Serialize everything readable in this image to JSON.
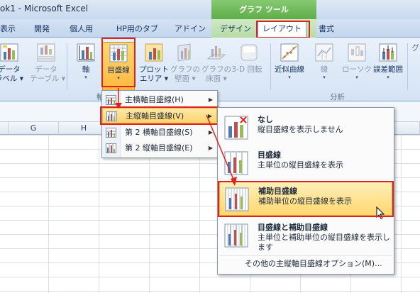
{
  "window": {
    "title": "ok1 - Microsoft Excel",
    "context_tab_group": "グラフ ツール"
  },
  "tabs": [
    {
      "label": "表示"
    },
    {
      "label": "開発"
    },
    {
      "label": "個人用"
    },
    {
      "label": "HP用のタブ"
    },
    {
      "label": "アドイン"
    },
    {
      "label": "デザイン"
    },
    {
      "label": "レイアウト",
      "active": true
    },
    {
      "label": "書式"
    }
  ],
  "ribbon": {
    "buttons": [
      {
        "label1": "データ",
        "label2": "ラベル ▾"
      },
      {
        "label1": "データ",
        "label2": "テーブル ▾"
      },
      {
        "label1": "軸",
        "label2": "▾"
      },
      {
        "label1": "目盛線",
        "label2": "▾"
      },
      {
        "label1": "プロット",
        "label2": "エリア ▾"
      },
      {
        "label1": "グラフの",
        "label2": "壁面 ▾"
      },
      {
        "label1": "グラフの",
        "label2": "床面 ▾"
      },
      {
        "label1": "3-D 回転",
        "label2": ""
      },
      {
        "label1": "近似曲線",
        "label2": "▾"
      },
      {
        "label1": "線",
        "label2": "▾"
      },
      {
        "label1": "ローソク",
        "label2": "▾"
      },
      {
        "label1": "誤差範囲",
        "label2": "▾"
      }
    ],
    "groups": {
      "axes_partial": "軸",
      "analysis": "分析"
    },
    "right_partial": "グ"
  },
  "sheet": {
    "columns": [
      "G",
      "H"
    ]
  },
  "submenu1": {
    "items": [
      {
        "label": "主横軸目盛線(H)"
      },
      {
        "label": "主縦軸目盛線(V)"
      },
      {
        "label": "第 2 横軸目盛線(S)"
      },
      {
        "label": "第 2 縦軸目盛線(E)"
      }
    ]
  },
  "submenu2": {
    "options": [
      {
        "title": "なし",
        "desc": "縦目盛線を表示しません"
      },
      {
        "title": "目盛線",
        "desc": "主単位の縦目盛線を表示"
      },
      {
        "title": "補助目盛線",
        "desc": "補助単位の縦目盛線を表示"
      },
      {
        "title": "目盛線と補助目盛線",
        "desc": "主単位と補助単位の縦目盛線を表示します"
      }
    ],
    "more": "その他の主縦軸目盛線オプション(M)..."
  },
  "colors": {
    "highlight_red": "#e0221c",
    "menu_highlight": "#ffd36b",
    "context_green": "#5fae4a"
  }
}
